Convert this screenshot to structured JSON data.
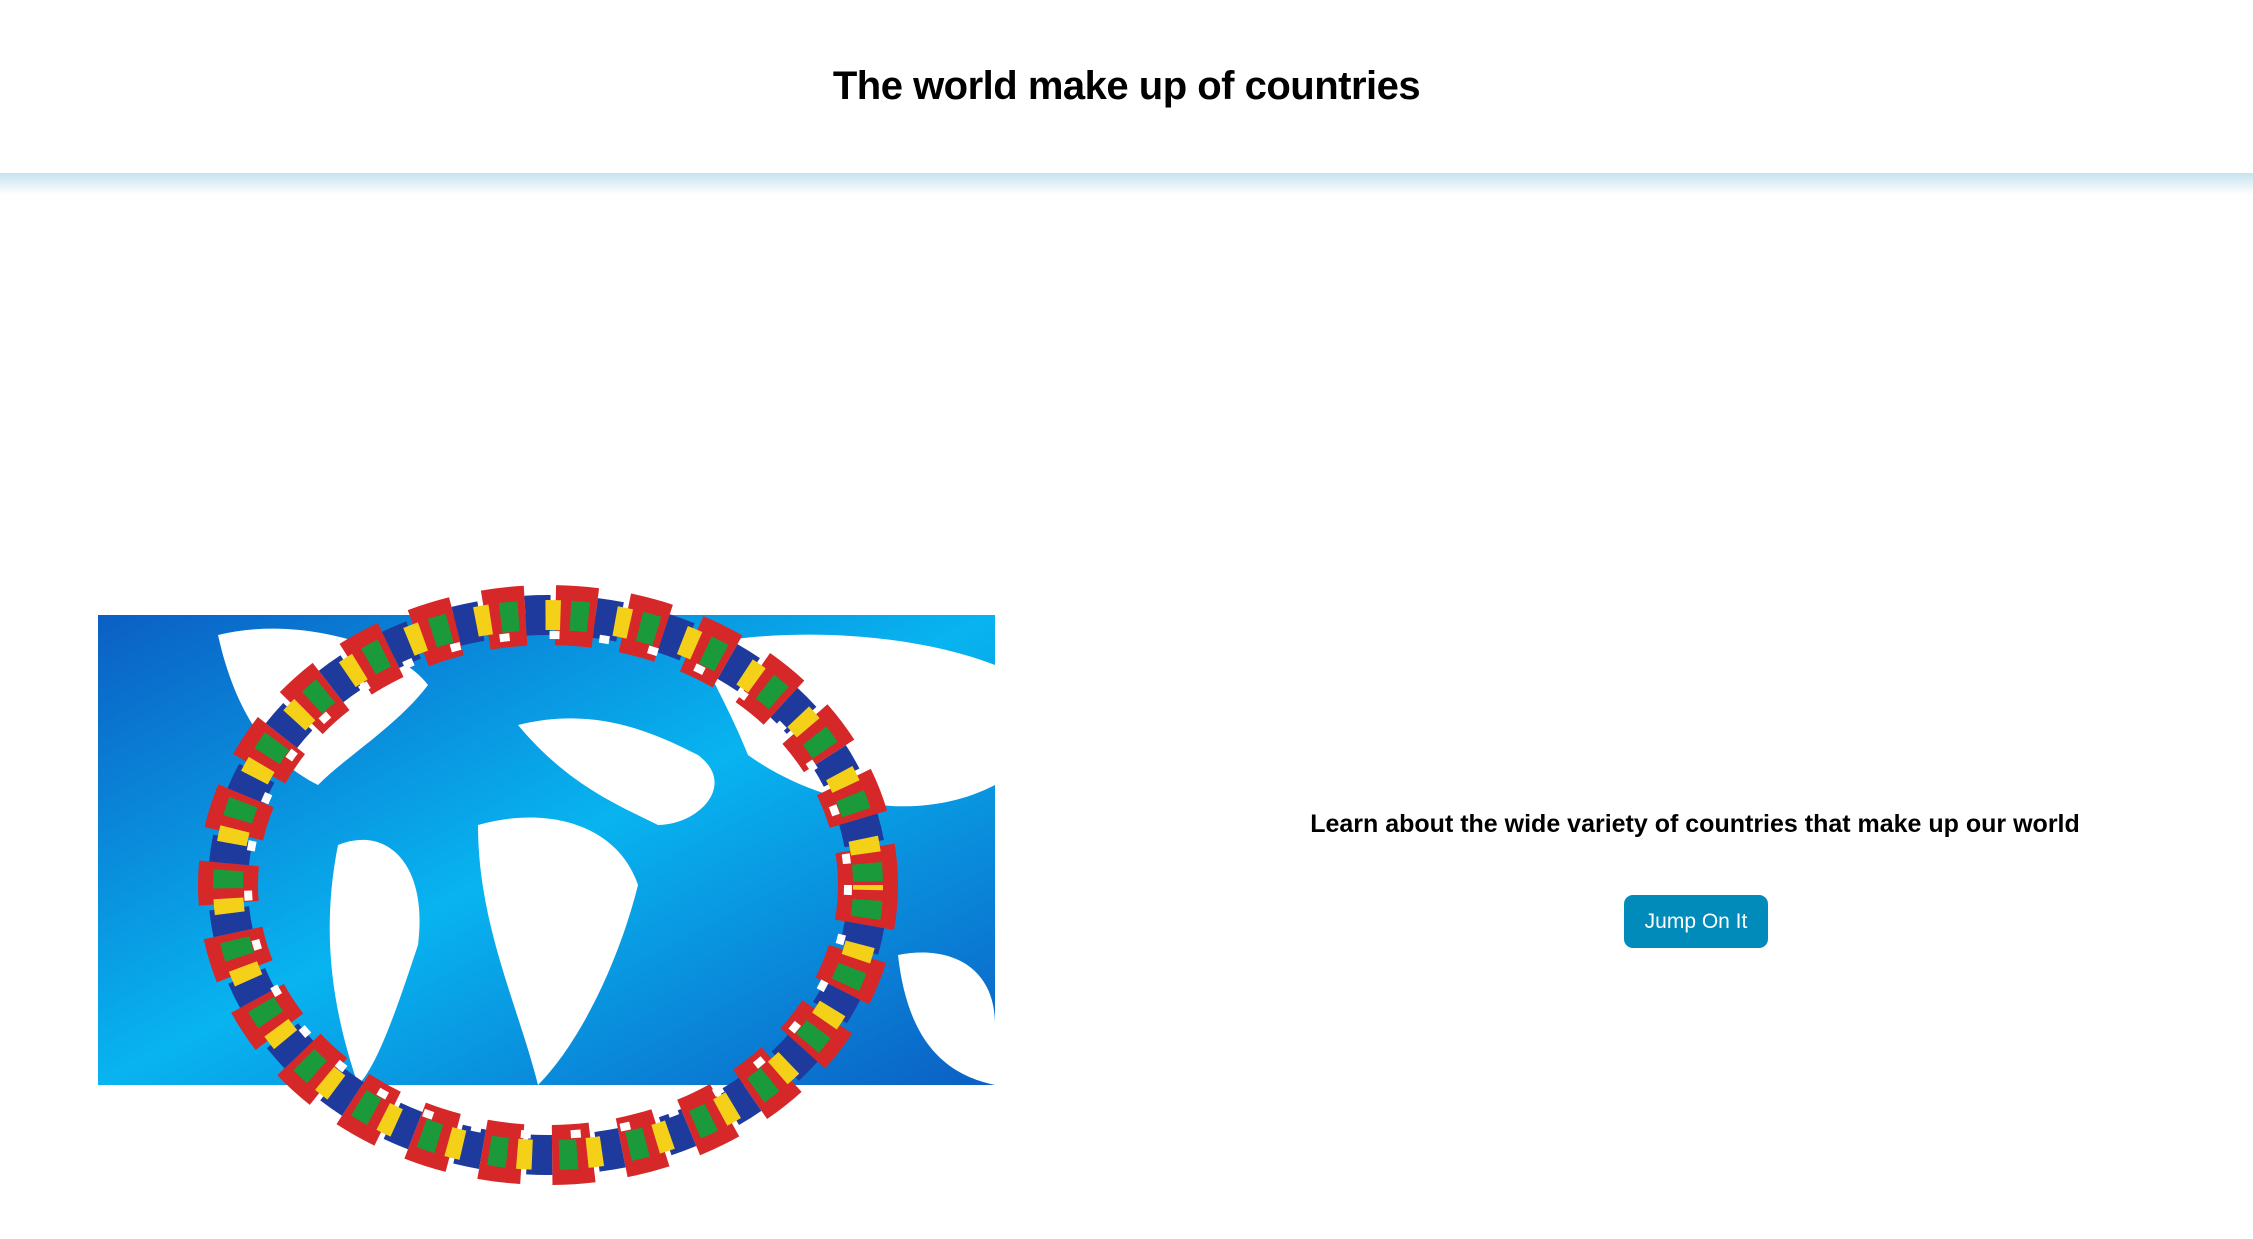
{
  "header": {
    "title": "The world make up of countries"
  },
  "hero": {
    "image": "world-map-flags-ring-image"
  },
  "main": {
    "tagline": "Learn about the wide variety of countries that make up our world",
    "cta_label": "Jump On It"
  },
  "colors": {
    "button": "#008bbb",
    "map_blue": "#0a9be8",
    "header_shadow": "#c6e3ee"
  }
}
